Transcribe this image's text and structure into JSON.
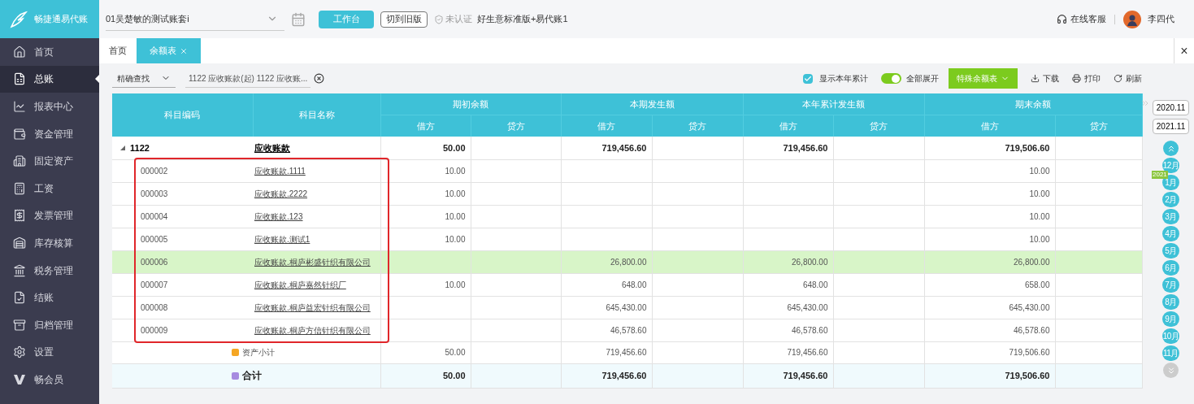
{
  "brand": "畅捷通易代账",
  "sidebar": {
    "items": [
      {
        "label": "首页",
        "selected": false
      },
      {
        "label": "总账",
        "selected": true
      },
      {
        "label": "报表中心",
        "selected": false
      },
      {
        "label": "资金管理",
        "selected": false
      },
      {
        "label": "固定资产",
        "selected": false
      },
      {
        "label": "工资",
        "selected": false
      },
      {
        "label": "发票管理",
        "selected": false
      },
      {
        "label": "库存核算",
        "selected": false
      },
      {
        "label": "税务管理",
        "selected": false
      },
      {
        "label": "结账",
        "selected": false
      },
      {
        "label": "归档管理",
        "selected": false
      },
      {
        "label": "设置",
        "selected": false
      },
      {
        "label": "畅会员",
        "selected": false
      }
    ]
  },
  "topbar": {
    "account": "01吴楚敏的测试账套i",
    "workbench": "工作台",
    "old_version": "切到旧版",
    "auth": "未认证",
    "edition": "好生意标准版+易代账1",
    "support": "在线客服",
    "user": "李四代"
  },
  "tabs": [
    {
      "label": "首页",
      "selected": false,
      "closable": false
    },
    {
      "label": "余额表",
      "selected": true,
      "closable": true
    }
  ],
  "close_all": "×",
  "toolbar": {
    "search_mode": "精确查找",
    "filter": "1122 应收账款(起) 1122 应收账...",
    "show_year": {
      "label": "显示本年累计",
      "checked": true
    },
    "expand_all": {
      "label": "全部展开",
      "on": true
    },
    "special": "特殊余额表",
    "download": "下载",
    "print": "打印",
    "refresh": "刷新"
  },
  "table": {
    "group_headers": [
      "期初余额",
      "本期发生额",
      "本年累计发生额",
      "期末余额"
    ],
    "code_header": "科目编码",
    "name_header": "科目名称",
    "sub_headers": [
      "借方",
      "贷方",
      "借方",
      "贷方",
      "借方",
      "贷方",
      "借方",
      "贷方"
    ],
    "rows": [
      {
        "kind": "group",
        "code": "1122",
        "name": "应收账款",
        "expanded": true,
        "selected": false,
        "cells": [
          "50.00",
          null,
          "719,456.60",
          null,
          "719,456.60",
          null,
          "719,506.60",
          null
        ]
      },
      {
        "kind": "item",
        "code": "000002",
        "name": "应收账款.1111",
        "selected": false,
        "cells": [
          "10.00",
          null,
          null,
          null,
          null,
          null,
          "10.00",
          null
        ]
      },
      {
        "kind": "item",
        "code": "000003",
        "name": "应收账款.2222",
        "selected": false,
        "cells": [
          "10.00",
          null,
          null,
          null,
          null,
          null,
          "10.00",
          null
        ]
      },
      {
        "kind": "item",
        "code": "000004",
        "name": "应收账款.123",
        "selected": false,
        "cells": [
          "10.00",
          null,
          null,
          null,
          null,
          null,
          "10.00",
          null
        ]
      },
      {
        "kind": "item",
        "code": "000005",
        "name": "应收账款.测试1",
        "selected": false,
        "cells": [
          "10.00",
          null,
          null,
          null,
          null,
          null,
          "10.00",
          null
        ]
      },
      {
        "kind": "item",
        "code": "000006",
        "name": "应收账款.桐庐彬盛针织有限公司",
        "selected": true,
        "cells": [
          null,
          null,
          "26,800.00",
          null,
          "26,800.00",
          null,
          "26,800.00",
          null
        ]
      },
      {
        "kind": "item",
        "code": "000007",
        "name": "应收账款.桐庐嘉然针织厂",
        "selected": false,
        "cells": [
          "10.00",
          null,
          "648.00",
          null,
          "648.00",
          null,
          "658.00",
          null
        ]
      },
      {
        "kind": "item",
        "code": "000008",
        "name": "应收账款.桐庐益宏针织有限公司",
        "selected": false,
        "cells": [
          null,
          null,
          "645,430.00",
          null,
          "645,430.00",
          null,
          "645,430.00",
          null
        ]
      },
      {
        "kind": "item",
        "code": "000009",
        "name": "应收账款.桐庐方信针织有限公司",
        "selected": false,
        "cells": [
          null,
          null,
          "46,578.60",
          null,
          "46,578.60",
          null,
          "46,578.60",
          null
        ]
      },
      {
        "kind": "subtotal",
        "name": "资产小计",
        "color": "#f5a623",
        "selected": false,
        "cells": [
          "50.00",
          null,
          "719,456.60",
          null,
          "719,456.60",
          null,
          "719,506.60",
          null
        ]
      },
      {
        "kind": "total",
        "name": "合计",
        "color": "#a78be0",
        "selected": false,
        "cells": [
          "50.00",
          null,
          "719,456.60",
          null,
          "719,456.60",
          null,
          "719,506.60",
          null
        ]
      }
    ]
  },
  "period": {
    "from": "2020.11",
    "to": "2021.11",
    "year_badge": "2021",
    "months": [
      {
        "label": "12月",
        "year_start": false
      },
      {
        "label": "1月",
        "year_start": true
      },
      {
        "label": "2月",
        "year_start": false
      },
      {
        "label": "3月",
        "year_start": false
      },
      {
        "label": "4月",
        "year_start": false
      },
      {
        "label": "5月",
        "year_start": false
      },
      {
        "label": "6月",
        "year_start": false
      },
      {
        "label": "7月",
        "year_start": false
      },
      {
        "label": "8月",
        "year_start": false
      },
      {
        "label": "9月",
        "year_start": false
      },
      {
        "label": "10月",
        "year_start": false
      },
      {
        "label": "11月",
        "year_start": false
      }
    ]
  }
}
